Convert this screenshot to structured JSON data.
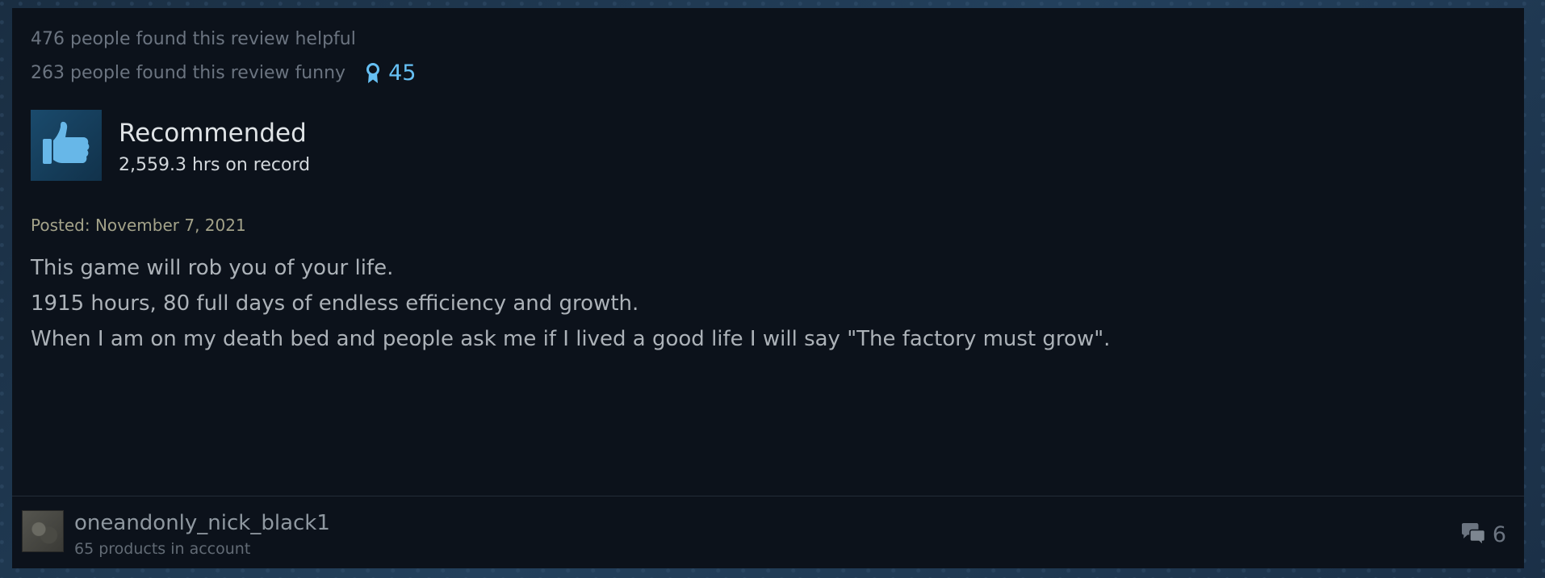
{
  "votes": {
    "helpful_text": "476 people found this review helpful",
    "funny_text": "263 people found this review funny",
    "award_count": "45"
  },
  "verdict": {
    "label": "Recommended",
    "hours": "2,559.3 hrs on record"
  },
  "posted": "Posted: November 7, 2021",
  "review": {
    "lines": [
      "This game will rob you of your life.",
      "1915 hours, 80 full days of endless efficiency and growth.",
      "When I am on my death bed and people ask me if I lived a good life I will say \"The factory must grow\"."
    ]
  },
  "author": {
    "name": "oneandonly_nick_black1",
    "products": "65 products in account"
  },
  "comments": {
    "count": "6"
  },
  "icons": {
    "award": "award-ribbon-icon",
    "thumb": "thumbs-up-icon",
    "comments": "comment-bubbles-icon"
  },
  "colors": {
    "accent": "#66c0f4",
    "card_bg": "#0c121b",
    "posted": "#a3a289"
  }
}
